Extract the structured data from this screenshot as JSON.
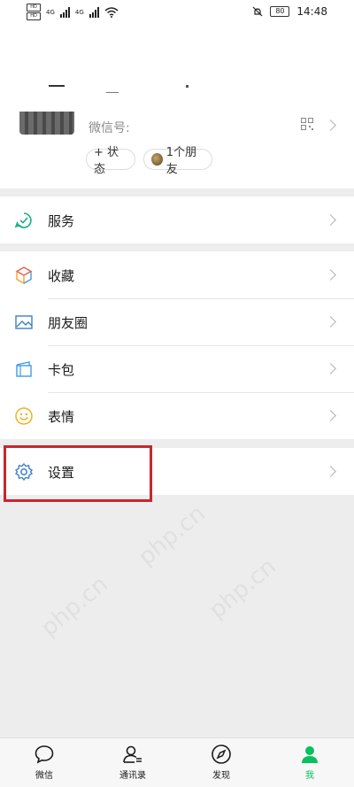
{
  "status_bar": {
    "sim1": "HD",
    "sim2": "HD",
    "net1": "4G",
    "net2": "4G",
    "battery": "80",
    "time": "14:48"
  },
  "profile": {
    "wechat_id_label": "微信号:",
    "status_button": "+ 状态",
    "friends_button": "1个朋友"
  },
  "menu": {
    "services": "服务",
    "favorites": "收藏",
    "moments": "朋友圈",
    "cards": "卡包",
    "stickers": "表情",
    "settings": "设置"
  },
  "tabbar": {
    "chats": "微信",
    "contacts": "通讯录",
    "discover": "发现",
    "me": "我"
  },
  "colors": {
    "accent": "#07c160",
    "highlight": "#c9262c"
  },
  "watermark": "php.cn"
}
